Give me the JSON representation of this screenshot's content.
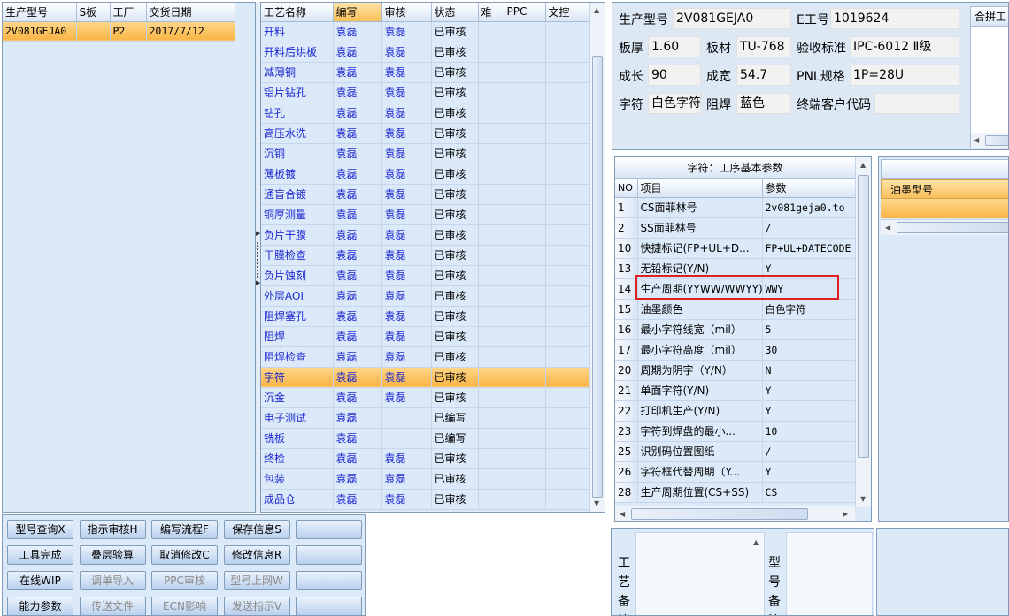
{
  "left_list": {
    "columns": [
      "生产型号",
      "S板",
      "工厂",
      "交货日期"
    ],
    "rows": [
      [
        "2V081GEJA0",
        "",
        "P2",
        "2017/7/12"
      ]
    ]
  },
  "process_table": {
    "columns": [
      "工艺名称",
      "编写",
      "审核",
      "状态",
      "难",
      "PPC",
      "文控"
    ],
    "rows": [
      [
        "开料",
        "袁磊",
        "袁磊",
        "已审核"
      ],
      [
        "开料后烘板",
        "袁磊",
        "袁磊",
        "已审核"
      ],
      [
        "减薄铜",
        "袁磊",
        "袁磊",
        "已审核"
      ],
      [
        "铝片钻孔",
        "袁磊",
        "袁磊",
        "已审核"
      ],
      [
        "钻孔",
        "袁磊",
        "袁磊",
        "已审核"
      ],
      [
        "高压水洗",
        "袁磊",
        "袁磊",
        "已审核"
      ],
      [
        "沉铜",
        "袁磊",
        "袁磊",
        "已审核"
      ],
      [
        "薄板镀",
        "袁磊",
        "袁磊",
        "已审核"
      ],
      [
        "通盲合镀",
        "袁磊",
        "袁磊",
        "已审核"
      ],
      [
        "铜厚测量",
        "袁磊",
        "袁磊",
        "已审核"
      ],
      [
        "负片干膜",
        "袁磊",
        "袁磊",
        "已审核"
      ],
      [
        "干膜检查",
        "袁磊",
        "袁磊",
        "已审核"
      ],
      [
        "负片蚀刻",
        "袁磊",
        "袁磊",
        "已审核"
      ],
      [
        "外层AOI",
        "袁磊",
        "袁磊",
        "已审核"
      ],
      [
        "阻焊塞孔",
        "袁磊",
        "袁磊",
        "已审核"
      ],
      [
        "阻焊",
        "袁磊",
        "袁磊",
        "已审核"
      ],
      [
        "阻焊检查",
        "袁磊",
        "袁磊",
        "已审核"
      ],
      [
        "字符",
        "袁磊",
        "袁磊",
        "已审核"
      ],
      [
        "沉金",
        "袁磊",
        "袁磊",
        "已审核"
      ],
      [
        "电子测试",
        "袁磊",
        "",
        "已编写"
      ],
      [
        "铣板",
        "袁磊",
        "",
        "已编写"
      ],
      [
        "终检",
        "袁磊",
        "袁磊",
        "已审核"
      ],
      [
        "包装",
        "袁磊",
        "袁磊",
        "已审核"
      ],
      [
        "成品仓",
        "袁磊",
        "袁磊",
        "已审核"
      ]
    ],
    "selected_row": "字符"
  },
  "info": {
    "prod_model_label": "生产型号",
    "prod_model": "2V081GEJA0",
    "e_num_label": "E工号",
    "e_num": "1019624",
    "thickness_label": "板厚",
    "thickness": "1.60",
    "material_label": "板材",
    "material": "TU-768",
    "accept_label": "验收标准",
    "accept": "IPC-6012 Ⅱ级",
    "length_label": "成长",
    "length": "90",
    "width_label": "成宽",
    "width": "54.7",
    "pnl_label": "PNL规格",
    "pnl": "1P=28U",
    "char_label": "字符",
    "char": "白色字符",
    "mask_label": "阻焊",
    "mask": "蓝色",
    "customer_label": "终端客户代码",
    "customer": "",
    "combine_label": "合拼工"
  },
  "params": {
    "title": "字符：工序基本参数",
    "columns": [
      "NO",
      "项目",
      "参数"
    ],
    "rows": [
      [
        "1",
        "CS面菲林号",
        "2v081geja0.to"
      ],
      [
        "2",
        "SS面菲林号",
        "/"
      ],
      [
        "10",
        "快捷标记(FP+UL+D...",
        "FP+UL+DATECODE"
      ],
      [
        "13",
        "无铅标记(Y/N)",
        "Y"
      ],
      [
        "14",
        "生产周期(YYWW/WWYY)",
        "WWY"
      ],
      [
        "15",
        "油墨颜色",
        "白色字符"
      ],
      [
        "16",
        "最小字符线宽（mil）",
        "5"
      ],
      [
        "17",
        "最小字符高度（mil）",
        "30"
      ],
      [
        "20",
        "周期为阴字（Y/N）",
        "N"
      ],
      [
        "21",
        "单面字符(Y/N)",
        "Y"
      ],
      [
        "22",
        "打印机生产(Y/N)",
        "Y"
      ],
      [
        "23",
        "字符到焊盘的最小...",
        "10"
      ],
      [
        "25",
        "识别码位置图纸",
        "/"
      ],
      [
        "26",
        "字符框代替周期（Y...",
        "Y"
      ],
      [
        "28",
        "生产周期位置(CS+SS)",
        "CS"
      ]
    ]
  },
  "ink": {
    "column": "油墨型号"
  },
  "notes": {
    "process_label": "工艺备注",
    "model_label": "型号备注"
  },
  "buttons": [
    [
      "型号查询X",
      "指示审核H",
      "编写流程F",
      "保存信息S",
      ""
    ],
    [
      "工具完成",
      "叠层验算",
      "取消修改C",
      "修改信息R",
      ""
    ],
    [
      "在线WIP",
      "调单导入",
      "PPC审核",
      "型号上网W",
      ""
    ],
    [
      "能力参数",
      "传送文件",
      "ECN影响",
      "发送指示V",
      ""
    ]
  ],
  "disabled_buttons": [
    "调单导入",
    "PPC审核",
    "型号上网W",
    "传送文件",
    "ECN影响",
    "发送指示V"
  ],
  "colors": {
    "panel_bg": "#dbe9f9",
    "selected_row": "#f9b546",
    "author_text": "#1f2ad0",
    "highlight_box": "#e02020"
  }
}
